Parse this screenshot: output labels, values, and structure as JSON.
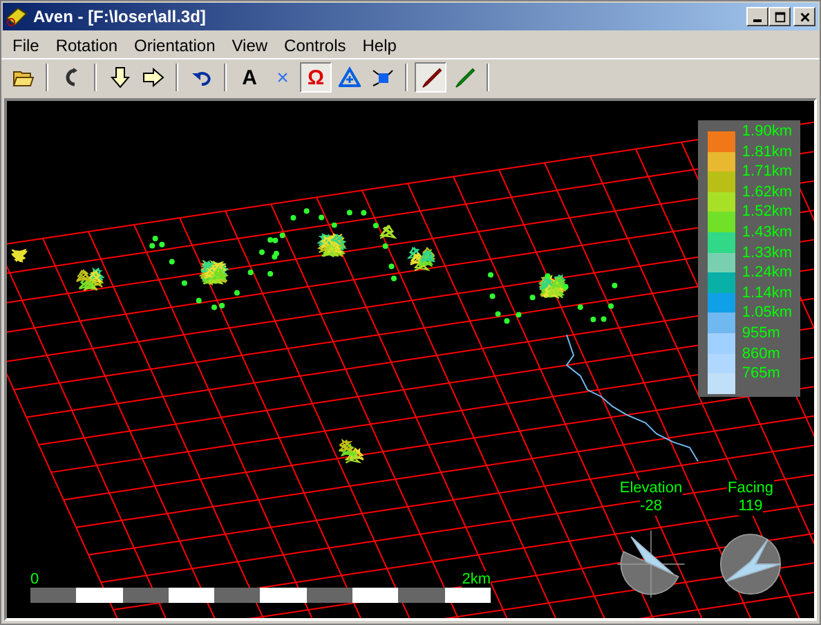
{
  "window": {
    "title": "Aven - [F:\\loser\\all.3d]"
  },
  "menu": [
    "File",
    "Rotation",
    "Orientation",
    "View",
    "Controls",
    "Help"
  ],
  "toolbar": [
    {
      "kind": "open",
      "pressed": false
    },
    {
      "kind": "separator"
    },
    {
      "kind": "rotate",
      "pressed": false
    },
    {
      "kind": "separator"
    },
    {
      "kind": "down",
      "pressed": false
    },
    {
      "kind": "right",
      "pressed": false
    },
    {
      "kind": "separator"
    },
    {
      "kind": "undo",
      "pressed": false
    },
    {
      "kind": "separator"
    },
    {
      "kind": "glyph",
      "label": "A",
      "pressed": false
    },
    {
      "kind": "glyph",
      "label": "×",
      "pressed": false
    },
    {
      "kind": "glyph",
      "label": "Ω",
      "pressed": true
    },
    {
      "kind": "triangle",
      "pressed": false
    },
    {
      "kind": "square",
      "pressed": false
    },
    {
      "kind": "separator"
    },
    {
      "kind": "redpen",
      "pressed": true
    },
    {
      "kind": "greenpen",
      "pressed": false
    },
    {
      "kind": "separator"
    }
  ],
  "legend": [
    {
      "label": "1.90km",
      "color": "#f07818"
    },
    {
      "label": "1.81km",
      "color": "#e8b830"
    },
    {
      "label": "1.71km",
      "color": "#b8c018"
    },
    {
      "label": "1.62km",
      "color": "#a8e028"
    },
    {
      "label": "1.52km",
      "color": "#70e028"
    },
    {
      "label": "1.43km",
      "color": "#30d888"
    },
    {
      "label": "1.33km",
      "color": "#78d0b0"
    },
    {
      "label": "1.24km",
      "color": "#08b0a8"
    },
    {
      "label": "1.14km",
      "color": "#10a0e8"
    },
    {
      "label": "1.05km",
      "color": "#70b8f0"
    },
    {
      "label": "955m",
      "color": "#a0d0ff"
    },
    {
      "label": "860m",
      "color": "#b0d8ff"
    },
    {
      "label": "765m",
      "color": "#c0e0f8"
    }
  ],
  "scale_bar": {
    "start": "0",
    "end": "2km"
  },
  "dials": [
    {
      "kind": "elevation",
      "label": "Elevation",
      "value": "-28"
    },
    {
      "kind": "compass",
      "label": "Facing",
      "value": "119"
    }
  ]
}
